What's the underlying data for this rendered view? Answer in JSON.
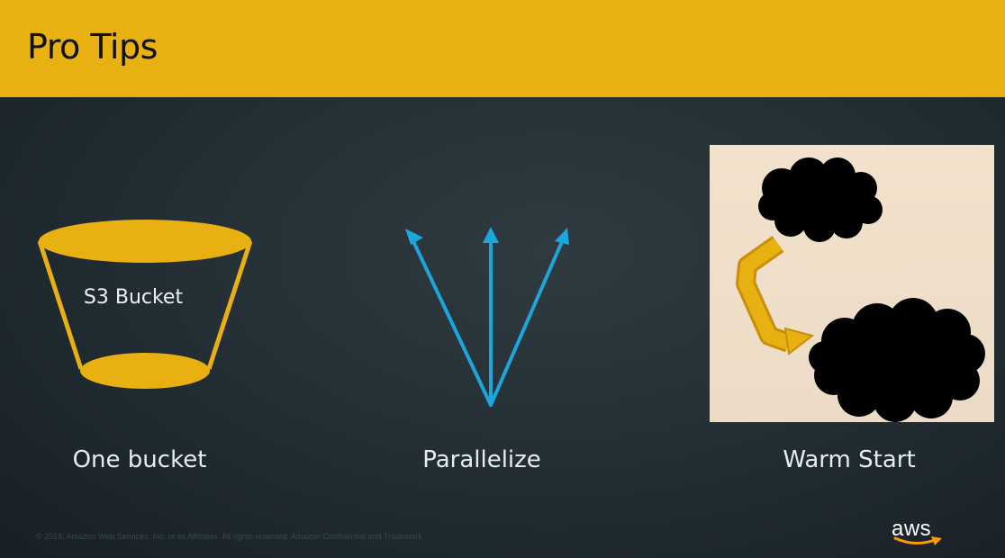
{
  "header": {
    "title": "Pro Tips"
  },
  "tips": [
    {
      "icon": "s3-bucket-icon",
      "icon_label": "S3 Bucket",
      "caption": "One bucket"
    },
    {
      "icon": "parallel-arrows-icon",
      "caption": "Parallelize"
    },
    {
      "icon": "warm-start-clouds-icon",
      "caption": "Warm Start"
    }
  ],
  "footer": {
    "copyright": "© 2019, Amazon Web Services, Inc. or its Affiliates. All rights reserved. Amazon Confidential and Trademark",
    "logo_text": "aws"
  },
  "colors": {
    "header_bg": "#e8b010",
    "background": "#222d33",
    "bucket": "#e8b010",
    "arrows": "#1ba6dc",
    "warm_panel": "#efdfca",
    "clouds": "#000000",
    "curved_arrow": "#e8b010",
    "aws_smile": "#ff9900"
  }
}
